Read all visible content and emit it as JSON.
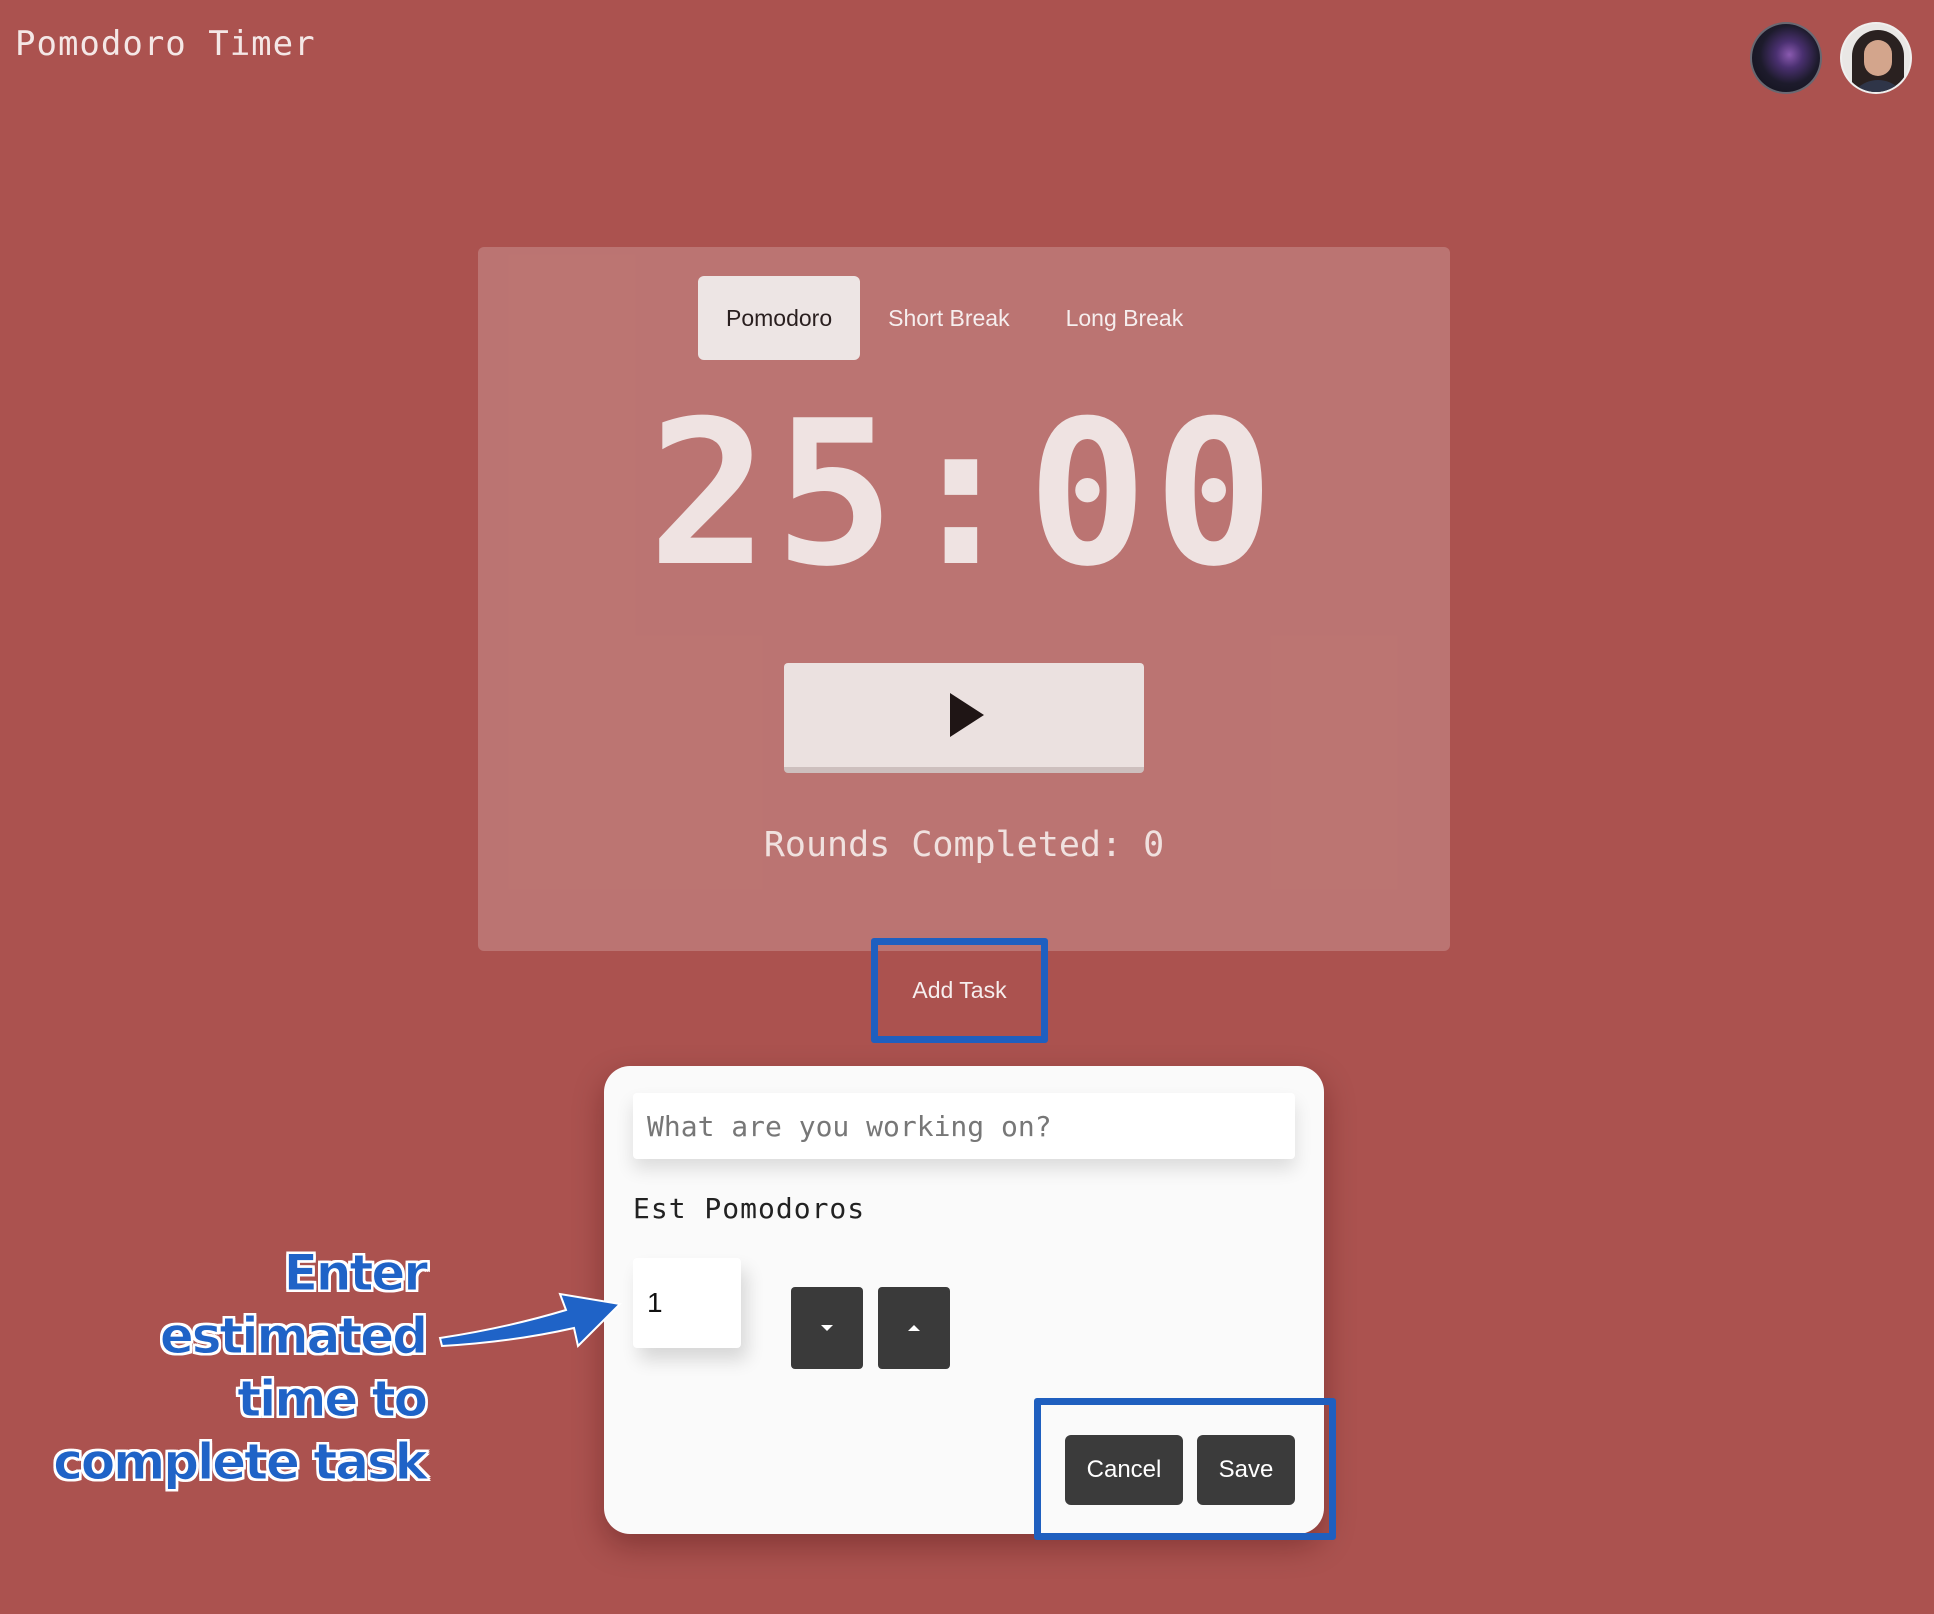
{
  "header": {
    "app_title": "Pomodoro Timer",
    "avatars": [
      "avatar-dark",
      "avatar-person"
    ]
  },
  "timer": {
    "tabs": [
      {
        "label": "Pomodoro",
        "active": true
      },
      {
        "label": "Short Break",
        "active": false
      },
      {
        "label": "Long Break",
        "active": false
      }
    ],
    "display": "25:00",
    "start_icon": "play-icon",
    "rounds_label": "Rounds Completed: 0"
  },
  "add_task": {
    "label": "Add Task"
  },
  "task_form": {
    "placeholder": "What are you working on?",
    "value": "",
    "est_label": "Est Pomodoros",
    "est_value": "1",
    "decrement_icon": "caret-down-icon",
    "increment_icon": "caret-up-icon",
    "cancel_label": "Cancel",
    "save_label": "Save"
  },
  "annotation": {
    "line1": "Enter estimated",
    "line2": "time to",
    "line3": "complete task"
  },
  "colors": {
    "background": "#ab524f",
    "highlight": "#1f5fbf",
    "annotation_text": "#1f63c7",
    "button_dark": "#3b3b3b"
  }
}
